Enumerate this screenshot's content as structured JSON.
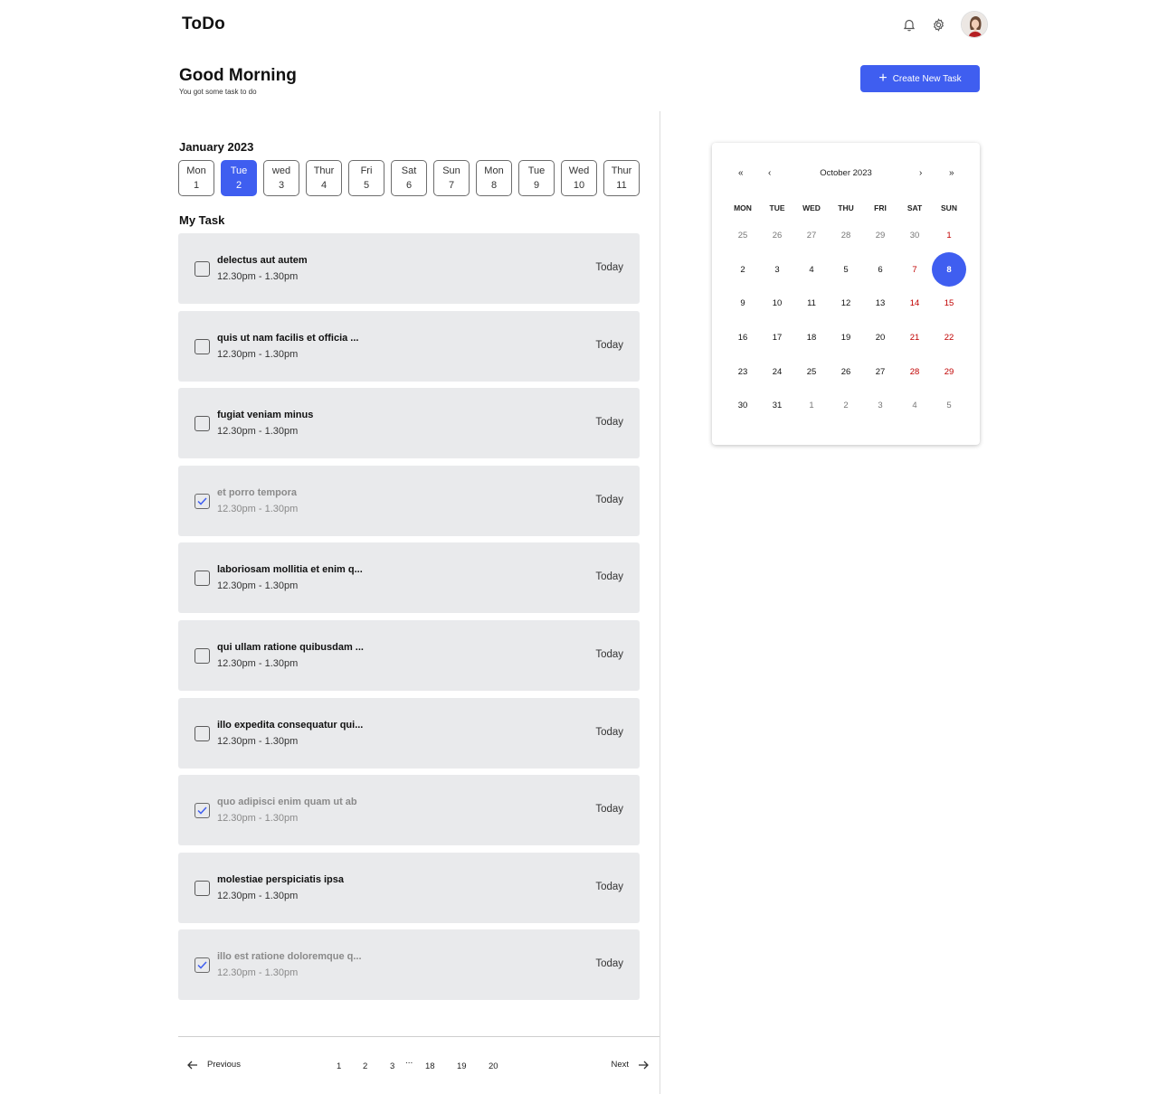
{
  "app": {
    "title": "ToDo"
  },
  "header": {
    "icons": [
      "bell-icon",
      "gear-icon",
      "avatar"
    ]
  },
  "greeting": {
    "title": "Good Morning",
    "subtitle": "You got some task to do"
  },
  "create_button": {
    "label": "Create New Task",
    "icon": "plus-icon"
  },
  "strip": {
    "month": "January 2023",
    "days": [
      {
        "name": "Mon",
        "num": "1"
      },
      {
        "name": "Tue",
        "num": "2"
      },
      {
        "name": "wed",
        "num": "3"
      },
      {
        "name": "Thur",
        "num": "4"
      },
      {
        "name": "Fri",
        "num": "5"
      },
      {
        "name": "Sat",
        "num": "6"
      },
      {
        "name": "Sun",
        "num": "7"
      },
      {
        "name": "Mon",
        "num": "8"
      },
      {
        "name": "Tue",
        "num": "9"
      },
      {
        "name": "Wed",
        "num": "10"
      },
      {
        "name": "Thur",
        "num": "11"
      }
    ],
    "selected_index": 1
  },
  "tasks_label": "My Task",
  "tasks": [
    {
      "title": "delectus aut autem",
      "time": "12.30pm - 1.30pm",
      "when": "Today",
      "done": false
    },
    {
      "title": "quis ut nam facilis et officia ...",
      "time": "12.30pm - 1.30pm",
      "when": "Today",
      "done": false
    },
    {
      "title": "fugiat veniam minus",
      "time": "12.30pm - 1.30pm",
      "when": "Today",
      "done": false
    },
    {
      "title": "et porro tempora",
      "time": "12.30pm - 1.30pm",
      "when": "Today",
      "done": true
    },
    {
      "title": "laboriosam mollitia et enim q...",
      "time": "12.30pm - 1.30pm",
      "when": "Today",
      "done": false
    },
    {
      "title": "qui ullam ratione quibusdam ...",
      "time": "12.30pm - 1.30pm",
      "when": "Today",
      "done": false
    },
    {
      "title": "illo expedita consequatur qui...",
      "time": "12.30pm - 1.30pm",
      "when": "Today",
      "done": false
    },
    {
      "title": "quo adipisci enim quam ut ab",
      "time": "12.30pm - 1.30pm",
      "when": "Today",
      "done": true
    },
    {
      "title": "molestiae perspiciatis ipsa",
      "time": "12.30pm - 1.30pm",
      "when": "Today",
      "done": false
    },
    {
      "title": "illo est ratione doloremque q...",
      "time": "12.30pm - 1.30pm",
      "when": "Today",
      "done": true
    }
  ],
  "pagination": {
    "prev": "Previous",
    "next": "Next",
    "pages_left": [
      "1",
      "2",
      "3"
    ],
    "ellipsis": "...",
    "pages_right": [
      "18",
      "19",
      "20"
    ]
  },
  "calendar": {
    "title": "October 2023",
    "nav": {
      "first": "«",
      "prev": "‹",
      "next": "›",
      "last": "»"
    },
    "weekdays": [
      "MON",
      "TUE",
      "WED",
      "THU",
      "FRI",
      "SAT",
      "SUN"
    ],
    "weeks": [
      [
        "25",
        "26",
        "27",
        "28",
        "29",
        "30",
        "1"
      ],
      [
        "2",
        "3",
        "4",
        "5",
        "6",
        "7",
        "8"
      ],
      [
        "9",
        "10",
        "11",
        "12",
        "13",
        "14",
        "15"
      ],
      [
        "16",
        "17",
        "18",
        "19",
        "20",
        "21",
        "22"
      ],
      [
        "23",
        "24",
        "25",
        "26",
        "27",
        "28",
        "29"
      ],
      [
        "30",
        "31",
        "1",
        "2",
        "3",
        "4",
        "5"
      ]
    ],
    "leading_outside_count": 6,
    "trailing_outside_count": 5,
    "selected": "8",
    "colors": {
      "accent": "#3f5ef0",
      "weekend": "#c00000",
      "outside": "#777777"
    }
  }
}
